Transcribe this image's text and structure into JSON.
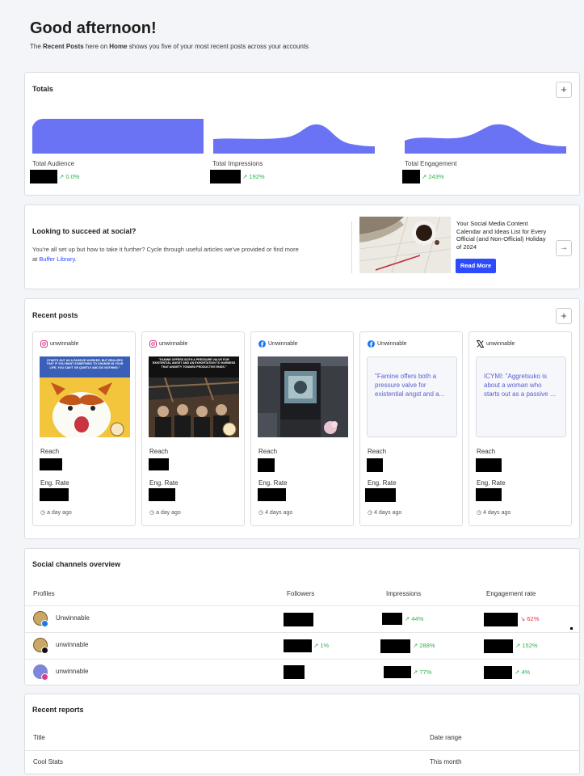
{
  "header": {
    "greeting": "Good afternoon!",
    "subtitle_pre": "The ",
    "subtitle_b1": "Recent Posts",
    "subtitle_mid": " here on ",
    "subtitle_b2": "Home",
    "subtitle_post": " shows you five of your most recent posts across your accounts"
  },
  "totals": {
    "title": "Totals",
    "add_label": "+",
    "metrics": [
      {
        "label": "Total Audience",
        "change": "↗ 0.0%"
      },
      {
        "label": "Total Impressions",
        "change": "↗ 192%"
      },
      {
        "label": "Total Engagement",
        "change": "↗ 243%"
      }
    ],
    "accent_color": "#6b73f5"
  },
  "promo": {
    "title": "Looking to succeed at social?",
    "body_pre": "You're all set up but how to take it further? Cycle through useful articles we've provided or find more at ",
    "link": "Buffer Library",
    "body_post": ".",
    "article_title": "Your Social Media Content Calendar and Ideas List for Every Official (and Non-Official) Holiday of 2024",
    "read_more": "Read More",
    "next_icon": "arrow-right-icon",
    "next_glyph": "→"
  },
  "recent_posts": {
    "title": "Recent posts",
    "add_label": "+",
    "reach_label": "Reach",
    "eng_label": "Eng. Rate",
    "posts": [
      {
        "network": "instagram",
        "account": "unwinnable",
        "image_text": "STARTS OUT AS A PASSIVE WORKER, BUT REALIZES THAT IF YOU WANT SOMETHING TO CHANGE IN YOUR LIFE, YOU CAN'T GE QUIETLY AND DO NOTHING.\"",
        "time": "a day ago"
      },
      {
        "network": "instagram",
        "account": "unwinnable",
        "image_text": "\"FAMINE OFFERS BOTH A PRESSURE VALVE FOR EXISTENTIAL ANGST AND AN EXHORTATION TO HARNESS THAT ANXIETY TOWARD PRODUCTIVE ENDS.\"",
        "time": "a day ago"
      },
      {
        "network": "facebook",
        "account": "Unwinnable",
        "time": "4 days ago"
      },
      {
        "network": "facebook",
        "account": "Unwinnable",
        "quote": "\"Famine offers both a pressure valve for existential angst and a...",
        "time": "4 days ago"
      },
      {
        "network": "x",
        "account": "unwinnable",
        "quote": "ICYMI: \"Aggretsuko is about a woman who starts out as a passive ...",
        "time": "4 days ago"
      }
    ]
  },
  "channels": {
    "title": "Social channels overview",
    "columns": [
      "Profiles",
      "Followers",
      "Impressions",
      "Engagement rate"
    ],
    "rows": [
      {
        "name": "Unwinnable",
        "network": "facebook",
        "followers_change": "",
        "impressions_change": "↗ 44%",
        "engagement_change": "↘ 62%"
      },
      {
        "name": "unwinnable",
        "network": "x",
        "followers_change": "↗ 1%",
        "impressions_change": "↗ 288%",
        "engagement_change": "↗ 152%"
      },
      {
        "name": "unwinnable",
        "network": "instagram",
        "followers_change": "",
        "impressions_change": "↗ 77%",
        "engagement_change": "↗ 4%"
      }
    ]
  },
  "reports": {
    "title": "Recent reports",
    "columns": [
      "Title",
      "Date range"
    ],
    "rows": [
      {
        "title": "Cool Stats",
        "range": "This month"
      }
    ]
  }
}
